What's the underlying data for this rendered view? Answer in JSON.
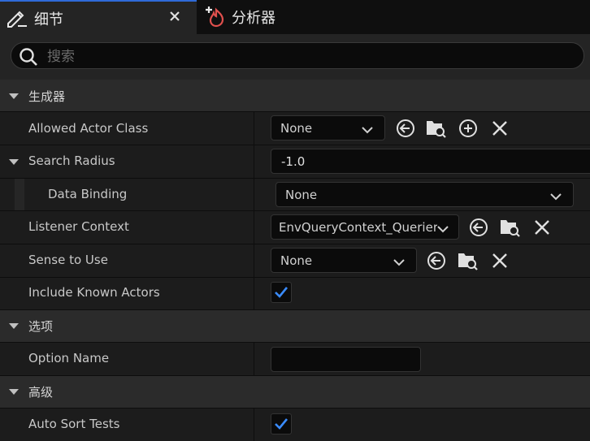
{
  "tabs": [
    {
      "label": "细节",
      "icon": "pencil-icon",
      "active": true
    },
    {
      "label": "分析器",
      "icon": "profiler-flame-icon",
      "active": false
    }
  ],
  "search": {
    "placeholder": "搜索",
    "value": ""
  },
  "categories": {
    "generator": "生成器",
    "options": "选项",
    "advanced": "高级"
  },
  "props": {
    "allowed_actor_class": {
      "label": "Allowed Actor Class",
      "value": "None"
    },
    "search_radius": {
      "label": "Search Radius",
      "value": "-1.0"
    },
    "data_binding": {
      "label": "Data Binding",
      "value": "None"
    },
    "listener_context": {
      "label": "Listener Context",
      "value": "EnvQueryContext_Querier"
    },
    "sense_to_use": {
      "label": "Sense to Use",
      "value": "None"
    },
    "include_known_actors": {
      "label": "Include Known Actors",
      "checked": true
    },
    "option_name": {
      "label": "Option Name",
      "value": ""
    },
    "auto_sort_tests": {
      "label": "Auto Sort Tests",
      "checked": true
    }
  },
  "colors": {
    "accent": "#2f6bd8",
    "check": "#3a8cff",
    "profiler": "#e0504d"
  }
}
